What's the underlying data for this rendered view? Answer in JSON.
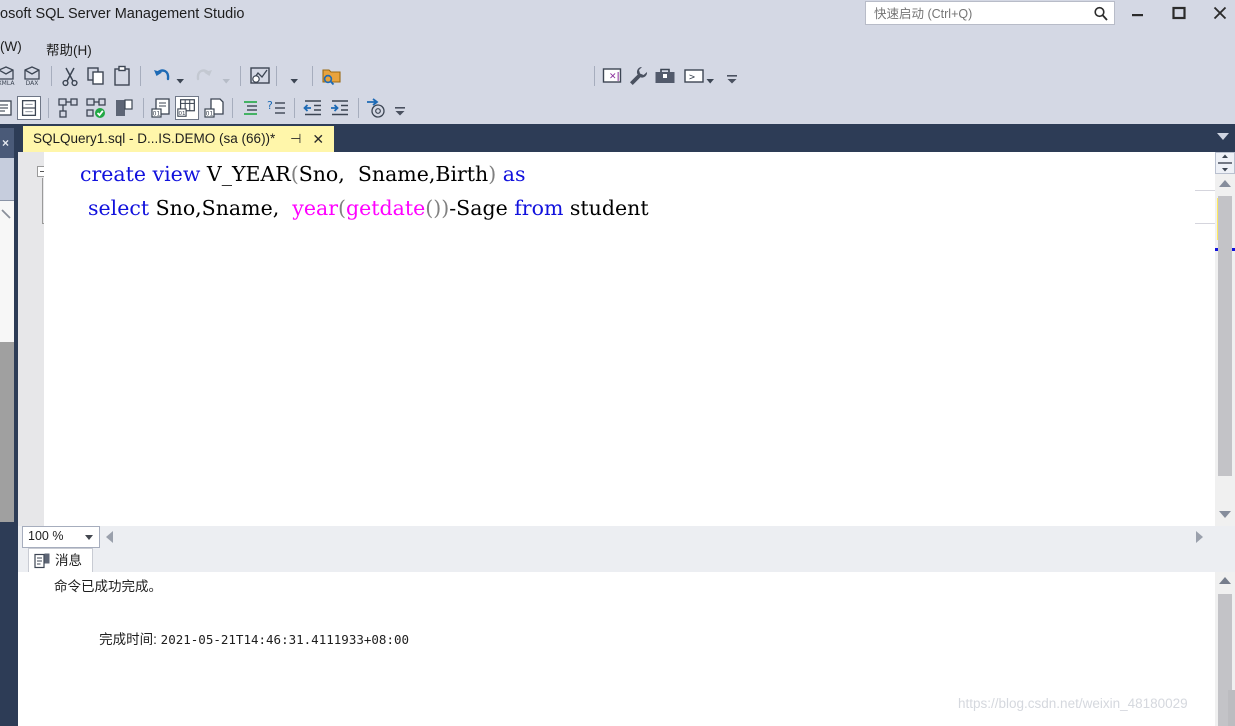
{
  "window": {
    "title": "osoft SQL Server Management Studio",
    "controls": {
      "minimize": "minimize-icon",
      "maximize": "maximize-icon",
      "close": "close-icon"
    }
  },
  "quick_launch": {
    "placeholder": "快速启动 (Ctrl+Q)",
    "value": "",
    "icon": "search-icon"
  },
  "menubar": {
    "items": [
      {
        "label": "(W)",
        "name": "menu-window"
      },
      {
        "label": "帮助(H)",
        "name": "menu-help"
      }
    ]
  },
  "toolbar_row1": {
    "items": [
      {
        "name": "xmla-icon",
        "label": "XMLA"
      },
      {
        "name": "dax-icon",
        "label": "DAX"
      },
      {
        "name": "cut-icon",
        "label": "剪切"
      },
      {
        "name": "copy-icon",
        "label": "复制"
      },
      {
        "name": "paste-icon",
        "label": "粘贴"
      },
      {
        "name": "undo-icon",
        "label": "撤消"
      },
      {
        "name": "redo-icon",
        "label": "恢复"
      },
      {
        "name": "estimated-plan-icon",
        "label": "显示估计的执行计划"
      },
      {
        "name": "folder-search-icon",
        "label": "在文件中查找"
      }
    ],
    "combo_value": "",
    "right_items": [
      {
        "name": "new-query-icon",
        "label": "新建查询"
      },
      {
        "name": "wrench-icon",
        "label": "设置"
      },
      {
        "name": "toolbox-icon",
        "label": "工具箱"
      },
      {
        "name": "console-icon",
        "label": "命令提示符"
      }
    ],
    "overflow": "toolbar-overflow-icon"
  },
  "toolbar_row2": {
    "items": [
      {
        "name": "results-to-text-icon",
        "label": "以文本格式显示结果"
      },
      {
        "name": "results-to-grid-icon",
        "label": "以网格显示结果"
      },
      {
        "name": "execute-icon",
        "label": "执行"
      },
      {
        "name": "parse-icon",
        "label": "分析"
      },
      {
        "name": "stop-icon",
        "label": "停止"
      },
      {
        "name": "include-actual-plan-icon",
        "label": "包括实际的执行计划"
      },
      {
        "name": "results-grid-icon",
        "label": "结果显示网格"
      },
      {
        "name": "results-file-icon",
        "label": "将结果保存到文件"
      },
      {
        "name": "comment-icon",
        "label": "注释选定行"
      },
      {
        "name": "uncomment-icon",
        "label": "取消注释选定行"
      },
      {
        "name": "decrease-indent-icon",
        "label": "减少缩进"
      },
      {
        "name": "increase-indent-icon",
        "label": "增加缩进"
      },
      {
        "name": "goto-icon",
        "label": "转到"
      }
    ],
    "overflow": "toolbar-overflow-icon"
  },
  "document_tab": {
    "label": "SQLQuery1.sql - D...IS.DEMO (sa (66))*",
    "pin_icon": "⊣",
    "close_icon": "✕"
  },
  "editor": {
    "zoom": "100 %",
    "lines": [
      {
        "tokens": [
          {
            "text": "create",
            "cls": "kw"
          },
          {
            "text": " ",
            "cls": "plain"
          },
          {
            "text": "view",
            "cls": "kw"
          },
          {
            "text": " V_YEAR",
            "cls": "plain"
          },
          {
            "text": "(",
            "cls": "paren"
          },
          {
            "text": "Sno,  Sname,Birth",
            "cls": "plain"
          },
          {
            "text": ")",
            "cls": "paren"
          },
          {
            "text": " ",
            "cls": "plain"
          },
          {
            "text": "as",
            "cls": "kw"
          }
        ]
      },
      {
        "tokens": [
          {
            "text": "select",
            "cls": "kw"
          },
          {
            "text": " Sno,Sname,  ",
            "cls": "plain"
          },
          {
            "text": "year",
            "cls": "fn"
          },
          {
            "text": "(",
            "cls": "paren"
          },
          {
            "text": "getdate",
            "cls": "fn"
          },
          {
            "text": "()",
            "cls": "paren"
          },
          {
            "text": ")",
            "cls": "paren"
          },
          {
            "text": "-Sage ",
            "cls": "plain"
          },
          {
            "text": "from",
            "cls": "kw"
          },
          {
            "text": " student",
            "cls": "plain"
          }
        ]
      }
    ]
  },
  "messages_pane": {
    "tab_label": "消息",
    "tab_icon": "messages-icon",
    "line1": "命令已成功完成。",
    "line2_label": "完成时间: ",
    "line2_value": "2021-05-21T14:46:31.4111933+08:00"
  },
  "watermark": "https://blog.csdn.net/weixin_48180029",
  "colors": {
    "chrome": "#d4d8e4",
    "tabstrip": "#2d3c56",
    "active_tab": "#fff6aa",
    "keyword": "#1111dd",
    "function": "#ff00ff",
    "changebar": "#ffe95c"
  }
}
